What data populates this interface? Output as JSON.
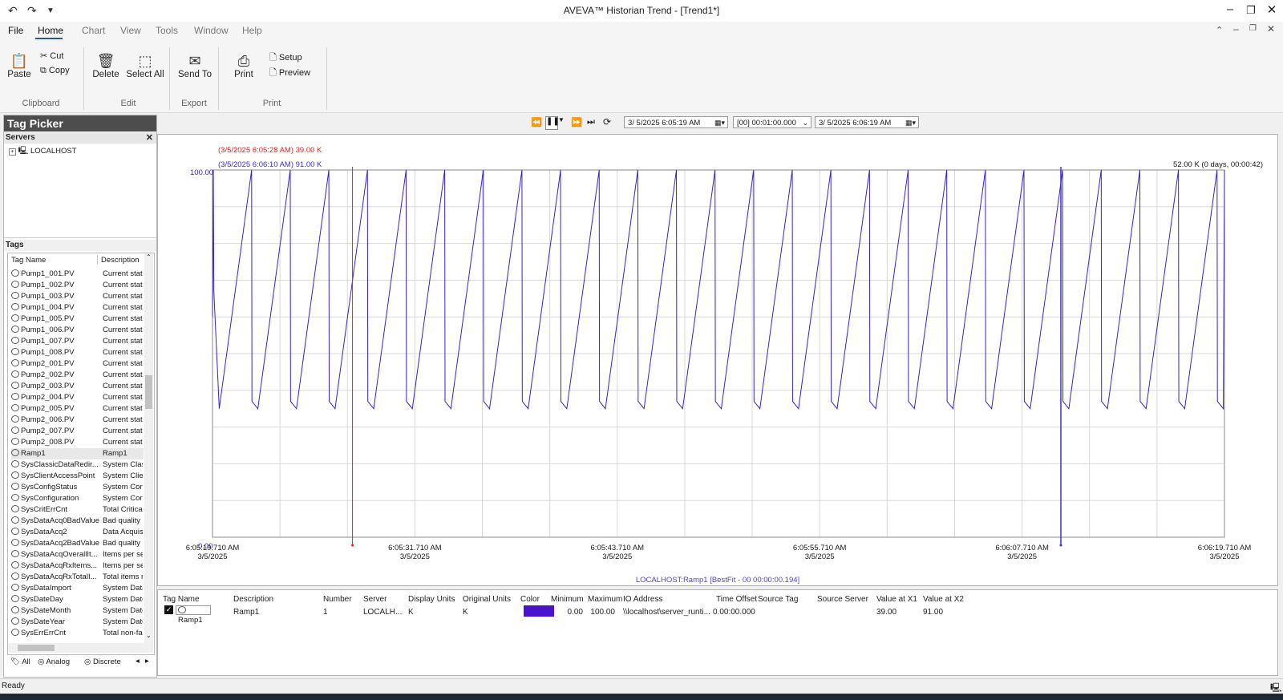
{
  "window": {
    "title": "AVEVA™ Historian Trend - [Trend1*]",
    "quick_access": [
      "undo-icon",
      "redo-icon",
      "customize-icon"
    ]
  },
  "menu": {
    "file": "File",
    "tabs": [
      "Home",
      "Chart",
      "View",
      "Tools",
      "Window",
      "Help"
    ]
  },
  "ribbon": {
    "paste": "Paste",
    "cut": "Cut",
    "copy": "Copy",
    "delete": "Delete",
    "select_all": "Select All",
    "send_to": "Send To",
    "print": "Print",
    "setup": "Setup",
    "preview": "Preview",
    "groups": {
      "clipboard": "Clipboard",
      "edit": "Edit",
      "export": "Export",
      "print": "Print"
    }
  },
  "tag_picker": {
    "title": "Tag Picker",
    "servers_label": "Servers",
    "server": "LOCALHOST",
    "tags_label": "Tags",
    "col_name": "Tag Name",
    "col_desc": "Description",
    "tags": [
      {
        "name": "Pump1_001.PV",
        "desc": "Current stat"
      },
      {
        "name": "Pump1_002.PV",
        "desc": "Current stat"
      },
      {
        "name": "Pump1_003.PV",
        "desc": "Current stat"
      },
      {
        "name": "Pump1_004.PV",
        "desc": "Current stat"
      },
      {
        "name": "Pump1_005.PV",
        "desc": "Current stat"
      },
      {
        "name": "Pump1_006.PV",
        "desc": "Current stat"
      },
      {
        "name": "Pump1_007.PV",
        "desc": "Current stat"
      },
      {
        "name": "Pump1_008.PV",
        "desc": "Current stat"
      },
      {
        "name": "Pump2_001.PV",
        "desc": "Current stat"
      },
      {
        "name": "Pump2_002.PV",
        "desc": "Current stat"
      },
      {
        "name": "Pump2_003.PV",
        "desc": "Current stat"
      },
      {
        "name": "Pump2_004.PV",
        "desc": "Current stat"
      },
      {
        "name": "Pump2_005.PV",
        "desc": "Current stat"
      },
      {
        "name": "Pump2_006.PV",
        "desc": "Current stat"
      },
      {
        "name": "Pump2_007.PV",
        "desc": "Current stat"
      },
      {
        "name": "Pump2_008.PV",
        "desc": "Current stat"
      },
      {
        "name": "Ramp1",
        "desc": "Ramp1"
      },
      {
        "name": "SysClassicDataRedir...",
        "desc": "System Clas"
      },
      {
        "name": "SysClientAccessPoint",
        "desc": "System Clier"
      },
      {
        "name": "SysConfigStatus",
        "desc": "System Con"
      },
      {
        "name": "SysConfiguration",
        "desc": "System Con"
      },
      {
        "name": "SysCritErrCnt",
        "desc": "Total Critica"
      },
      {
        "name": "SysDataAcq0BadValues",
        "desc": "Bad quality"
      },
      {
        "name": "SysDataAcq2",
        "desc": "Data Acquis"
      },
      {
        "name": "SysDataAcq2BadValues",
        "desc": "Bad quality"
      },
      {
        "name": "SysDataAcqOverallIt...",
        "desc": "Items per se"
      },
      {
        "name": "SysDataAcqRxItems...",
        "desc": "Items per se"
      },
      {
        "name": "SysDataAcqRxTotalI...",
        "desc": "Total items r"
      },
      {
        "name": "SysDataImport",
        "desc": "System Data"
      },
      {
        "name": "SysDateDay",
        "desc": "System Date"
      },
      {
        "name": "SysDateMonth",
        "desc": "System Date"
      },
      {
        "name": "SysDateYear",
        "desc": "System Date"
      },
      {
        "name": "SysErrErrCnt",
        "desc": "Total non-fa"
      }
    ],
    "bottom_tabs": [
      "All",
      "Analog",
      "Discrete"
    ]
  },
  "toolbar": {
    "start_time": "3/  5/2025   6:05:19 AM",
    "duration": "[00] 00:01:00.000",
    "end_time": "3/  5/2025   6:06:19 AM"
  },
  "chart": {
    "cursor1_label": "(3/5/2025 6:05:28 AM) 39.00 K",
    "cursor2_label": "(3/5/2025 6:06:10 AM) 91.00 K",
    "delta_label": "52.00 K (0 days, 00:00:42)",
    "ymax_label": "100.00",
    "ymin_label": "0.00",
    "x_ticks": [
      {
        "time": "6:05:19.710 AM",
        "date": "3/5/2025"
      },
      {
        "time": "6:05:31.710 AM",
        "date": "3/5/2025"
      },
      {
        "time": "6:05:43.710 AM",
        "date": "3/5/2025"
      },
      {
        "time": "6:05:55.710 AM",
        "date": "3/5/2025"
      },
      {
        "time": "6:06:07.710 AM",
        "date": "3/5/2025"
      },
      {
        "time": "6:06:19.710 AM",
        "date": "3/5/2025"
      }
    ],
    "footer": "LOCALHOST:Ramp1 [BestFit - 00 00:00:00.194]",
    "series_color": "#3f1fc8",
    "cursor1_color": "#e8201e",
    "cursor2_color": "#3a2ee0"
  },
  "chart_data": {
    "type": "line",
    "xlabel": "",
    "ylabel": "",
    "ylim": [
      0,
      100
    ],
    "xlim_seconds": [
      0,
      60
    ],
    "series": [
      {
        "name": "Ramp1",
        "pattern": "sawtooth",
        "min": 35,
        "max": 100,
        "period_seconds": 2.133,
        "samples_per_period_from_min_to_max": "linear"
      }
    ],
    "cursors": [
      {
        "time": "3/5/2025 6:05:28 AM",
        "value": 39.0,
        "units": "K"
      },
      {
        "time": "3/5/2025 6:06:10 AM",
        "value": 91.0,
        "units": "K"
      }
    ]
  },
  "tag_table": {
    "headers": [
      "Tag Name",
      "Description",
      "Number",
      "Server",
      "Display Units",
      "Original Units",
      "Color",
      "Minimum",
      "Maximum",
      "IO Address",
      "Time Offset",
      "Source Tag",
      "Source Server",
      "Value at X1",
      "Value at X2"
    ],
    "row": {
      "tag_name": "Ramp1",
      "description": "Ramp1",
      "number": "1",
      "server": "LOCALH...",
      "display_units": "K",
      "original_units": "K",
      "minimum": "0.00",
      "maximum": "100.00",
      "io_address": "\\\\localhost\\server_runti...",
      "time_offset": "0.00:00.000",
      "source_tag": "",
      "source_server": "",
      "value_x1": "39.00",
      "value_x2": "91.00",
      "color": "#4a12cc"
    }
  },
  "status": {
    "text": "Ready"
  }
}
